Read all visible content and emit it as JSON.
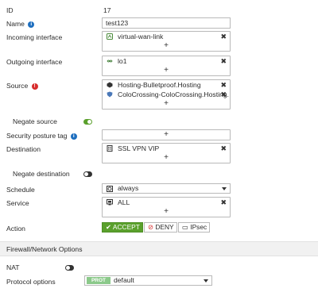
{
  "form": {
    "id": {
      "label": "ID",
      "value": "17"
    },
    "name": {
      "label": "Name",
      "info_icon": "info-icon",
      "value": "test123"
    },
    "incoming_interface": {
      "label": "Incoming interface",
      "entries": [
        {
          "icon": "sd-wan-icon",
          "text": "virtual-wan-link"
        }
      ],
      "add_label": "+"
    },
    "outgoing_interface": {
      "label": "Outgoing interface",
      "entries": [
        {
          "icon": "loopback-icon",
          "text": "lo1"
        }
      ],
      "add_label": "+"
    },
    "source": {
      "label": "Source",
      "info_icon": "warning-info-icon",
      "entries": [
        {
          "icon": "isdb-icon",
          "text": "Hosting-Bulletproof.Hosting"
        },
        {
          "icon": "isdb-icon",
          "text": "ColoCrossing-ColoCrossing.Hosting."
        }
      ],
      "add_label": "+"
    },
    "negate_source": {
      "label": "Negate source",
      "enabled": true
    },
    "security_posture_tag": {
      "label": "Security posture tag",
      "info_icon": "info-icon",
      "add_label": "+"
    },
    "destination": {
      "label": "Destination",
      "entries": [
        {
          "icon": "address-icon",
          "text": "SSL VPN VIP"
        }
      ],
      "add_label": "+"
    },
    "negate_destination": {
      "label": "Negate destination",
      "enabled": false
    },
    "schedule": {
      "label": "Schedule",
      "value": "always",
      "icon": "schedule-icon"
    },
    "service": {
      "label": "Service",
      "entries": [
        {
          "icon": "service-icon",
          "text": "ALL"
        }
      ],
      "add_label": "+"
    },
    "action": {
      "label": "Action",
      "options": [
        {
          "icon": "check-icon",
          "text": "ACCEPT",
          "selected": true
        },
        {
          "icon": "deny-icon",
          "text": "DENY",
          "selected": false
        },
        {
          "icon": "ipsec-icon",
          "text": "IPsec",
          "selected": false
        }
      ]
    }
  },
  "section": {
    "title": "Firewall/Network Options"
  },
  "network": {
    "nat": {
      "label": "NAT",
      "enabled": false
    },
    "protocol_options": {
      "label": "Protocol options",
      "badge": "PROT",
      "value": "default"
    }
  },
  "colors": {
    "accept_green": "#5aa02c",
    "info_blue": "#1e6fbf",
    "warning_red": "#d72c2c",
    "badge_green": "#8bc98a"
  },
  "remove_label": "✖"
}
